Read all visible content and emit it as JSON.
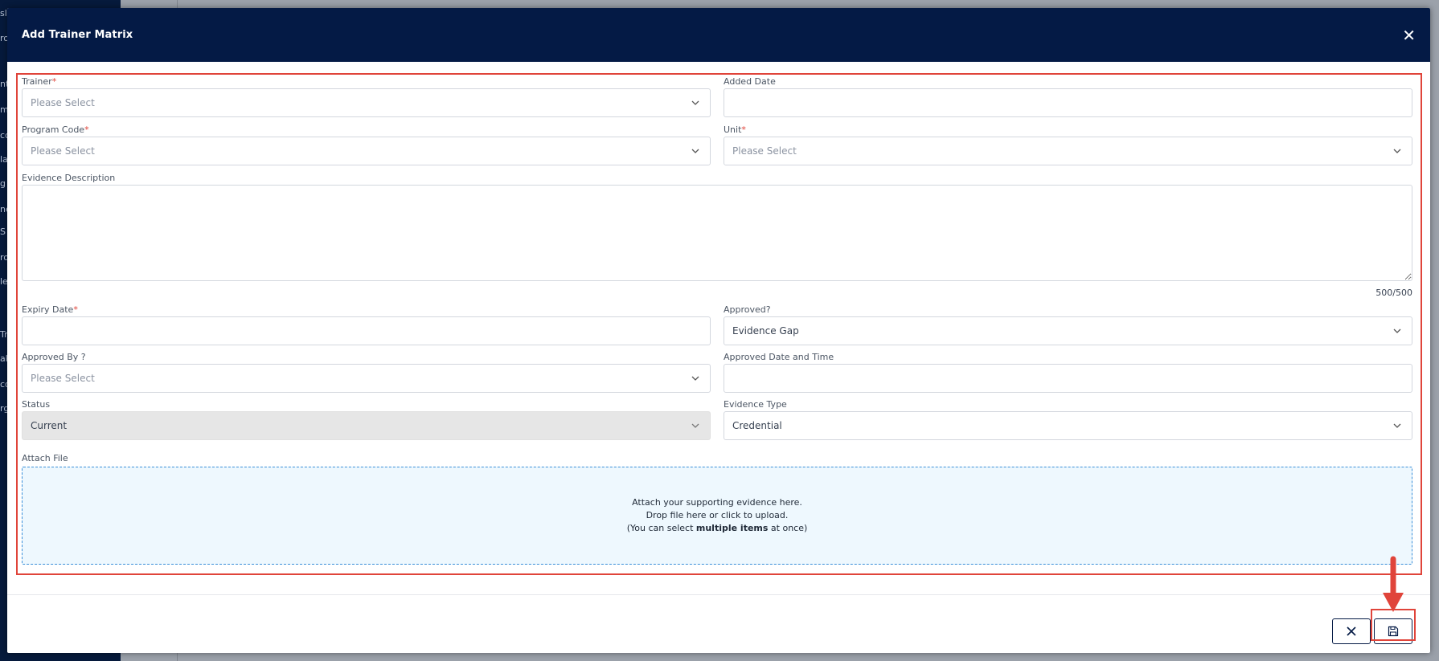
{
  "modal": {
    "title": "Add Trainer Matrix"
  },
  "fields": {
    "trainer": {
      "label": "Trainer",
      "required": "*",
      "placeholder": "Please Select"
    },
    "added_date": {
      "label": "Added Date",
      "value": ""
    },
    "program_code": {
      "label": "Program Code",
      "required": "*",
      "placeholder": "Please Select"
    },
    "unit": {
      "label": "Unit",
      "required": "*",
      "placeholder": "Please Select"
    },
    "evidence_description": {
      "label": "Evidence Description",
      "value": "",
      "counter": "500/500"
    },
    "expiry_date": {
      "label": "Expiry Date",
      "required": "*",
      "value": ""
    },
    "approved": {
      "label": "Approved?",
      "value": "Evidence Gap"
    },
    "approved_by": {
      "label": "Approved By ?",
      "placeholder": "Please Select"
    },
    "approved_date_time": {
      "label": "Approved Date and Time",
      "value": ""
    },
    "status": {
      "label": "Status",
      "value": "Current"
    },
    "evidence_type": {
      "label": "Evidence Type",
      "value": "Credential"
    },
    "attach_file": {
      "label": "Attach File",
      "line1": "Attach your supporting evidence here.",
      "line2": "Drop file here or click to upload.",
      "line3_prefix": "(You can select ",
      "line3_bold": "multiple items",
      "line3_suffix": " at once)"
    }
  },
  "background_sidebar_letters": [
    "sl",
    "ro",
    "nt",
    "m",
    "cc",
    "la",
    "g",
    "ne",
    "S",
    "ro",
    "le",
    "Tr",
    "ak",
    "co",
    "rg"
  ],
  "colors": {
    "header_bg": "#041a45",
    "highlight": "#e0443a",
    "drop_zone_bg": "#eef8fe",
    "drop_zone_border": "#3a8fd9"
  },
  "icons": {
    "close": "close-icon",
    "chevron": "chevron-down-icon",
    "cancel": "x-icon",
    "save": "save-icon"
  }
}
